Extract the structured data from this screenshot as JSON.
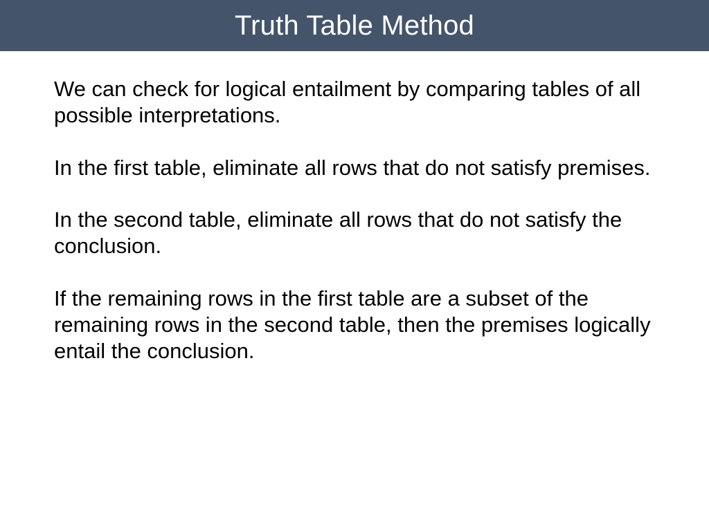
{
  "title": "Truth Table Method",
  "paragraphs": [
    "We can check for logical entailment by comparing tables of all possible interpretations.",
    "In the first table, eliminate all rows that do not satisfy premises.",
    "In the second table, eliminate all rows that do not satisfy the conclusion.",
    "If the remaining rows in the first table are a subset of the remaining rows in the second table, then the premises logically entail the conclusion."
  ]
}
